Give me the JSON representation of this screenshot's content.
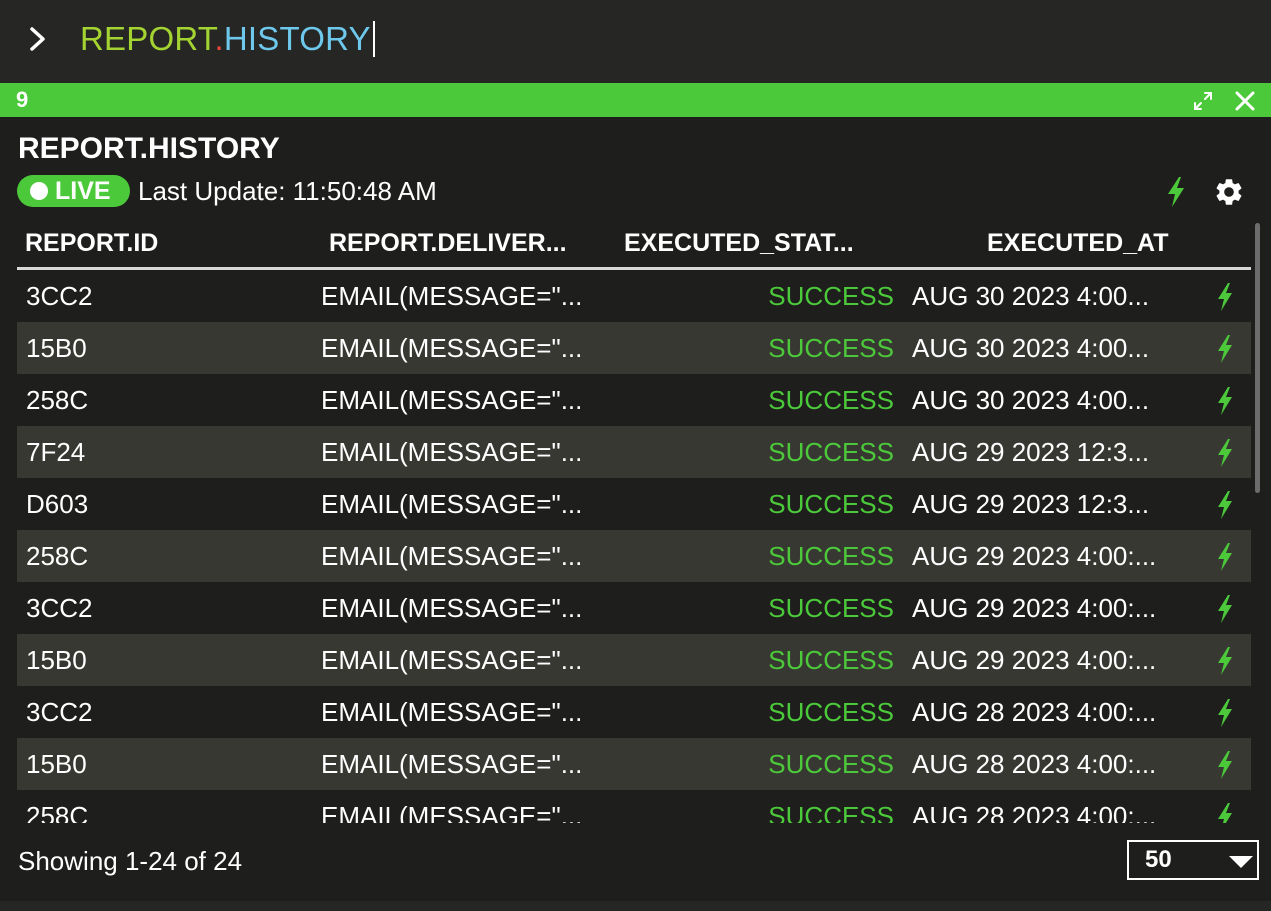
{
  "command_bar": {
    "prefix": "REPORT",
    "dot": ".",
    "suffix": "HISTORY",
    "icon": "chevron-right-icon"
  },
  "panel": {
    "tab_number": "9",
    "title": "REPORT.HISTORY",
    "live_label": "LIVE",
    "last_update": "Last Update: 11:50:48 AM",
    "accent_color": "#4cc93a",
    "icons": [
      "expand-icon",
      "close-icon",
      "lightning-icon",
      "gear-icon"
    ]
  },
  "table": {
    "columns": [
      "REPORT.ID",
      "REPORT.DELIVER...",
      "EXECUTED_STAT...",
      "EXECUTED_AT"
    ],
    "rows": [
      [
        "3CC2",
        "EMAIL(MESSAGE=\"...",
        "SUCCESS",
        "AUG 30 2023 4:00..."
      ],
      [
        "15B0",
        "EMAIL(MESSAGE=\"...",
        "SUCCESS",
        "AUG 30 2023 4:00..."
      ],
      [
        "258C",
        "EMAIL(MESSAGE=\"...",
        "SUCCESS",
        "AUG 30 2023 4:00..."
      ],
      [
        "7F24",
        "EMAIL(MESSAGE=\"...",
        "SUCCESS",
        "AUG 29 2023 12:3..."
      ],
      [
        "D603",
        "EMAIL(MESSAGE=\"...",
        "SUCCESS",
        "AUG 29 2023 12:3..."
      ],
      [
        "258C",
        "EMAIL(MESSAGE=\"...",
        "SUCCESS",
        "AUG 29 2023 4:00:..."
      ],
      [
        "3CC2",
        "EMAIL(MESSAGE=\"...",
        "SUCCESS",
        "AUG 29 2023 4:00:..."
      ],
      [
        "15B0",
        "EMAIL(MESSAGE=\"...",
        "SUCCESS",
        "AUG 29 2023 4:00:..."
      ],
      [
        "3CC2",
        "EMAIL(MESSAGE=\"...",
        "SUCCESS",
        "AUG 28 2023 4:00:..."
      ],
      [
        "15B0",
        "EMAIL(MESSAGE=\"...",
        "SUCCESS",
        "AUG 28 2023 4:00:..."
      ],
      [
        "258C",
        "EMAIL(MESSAGE=\"...",
        "SUCCESS",
        "AUG 28 2023 4:00:..."
      ]
    ],
    "status_color": "#4cc93a"
  },
  "footer": {
    "showing": "Showing 1-24 of 24",
    "page_size": "50"
  }
}
